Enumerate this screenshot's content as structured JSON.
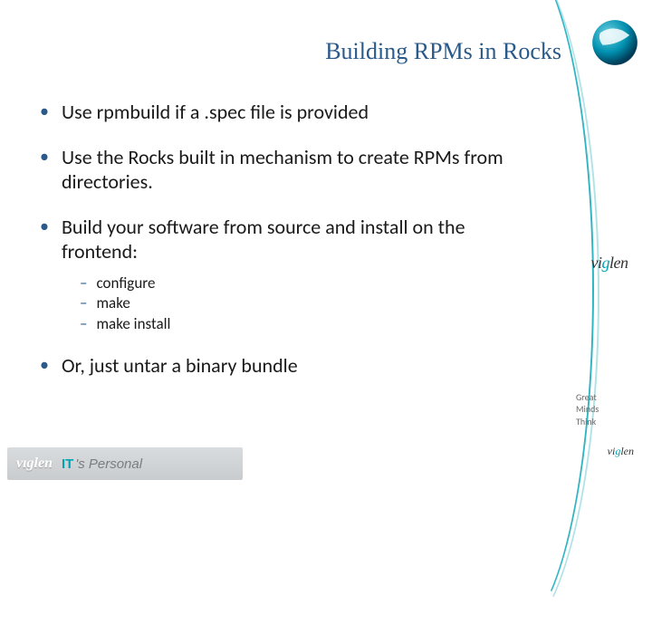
{
  "title": "Building RPMs in Rocks",
  "bullets": [
    {
      "text": "Use rpmbuild if a .spec file is provided"
    },
    {
      "text": "Use the Rocks built in mechanism to create RPMs from directories."
    },
    {
      "text": "Build your software from source and install on the frontend:"
    },
    {
      "text": "Or, just untar a binary bundle"
    }
  ],
  "sublist": [
    "configure",
    "make",
    "make install"
  ],
  "brand": {
    "name": "viglen",
    "tagline_lines": [
      "Great",
      "Minds",
      "Think"
    ],
    "footer_tag": "IT's Personal"
  }
}
